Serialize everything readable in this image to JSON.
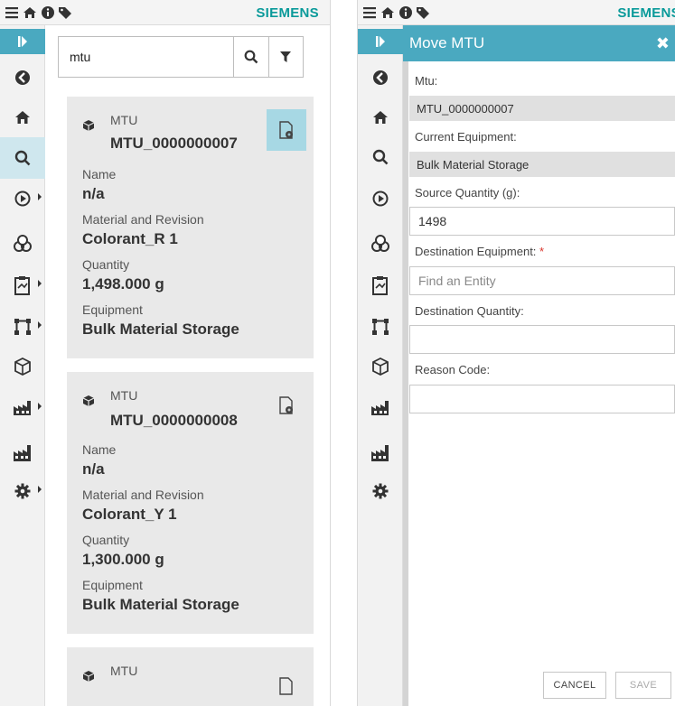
{
  "brand": "SIEMENS",
  "colors": {
    "accent": "#4aa9c0",
    "brand": "#0a9a9a",
    "card_bg": "#e9e9e9",
    "selected": "#a7d8e4"
  },
  "topbar_icons": [
    "menu-icon",
    "home-icon",
    "info-icon",
    "tags-icon"
  ],
  "rail_icons": [
    "expand-icon",
    "back-icon",
    "home-icon",
    "search-icon",
    "play-icon",
    "materials-icon",
    "clipboard-icon",
    "routing-icon",
    "box-icon",
    "factory-icon",
    "plant-icon",
    "gear-icon"
  ],
  "search": {
    "value": "mtu"
  },
  "results": [
    {
      "type_label": "MTU",
      "id": "MTU_0000000007",
      "name_label": "Name",
      "name": "n/a",
      "material_label": "Material and Revision",
      "material": "Colorant_R 1",
      "quantity_label": "Quantity",
      "quantity": "1,498.000 g",
      "equipment_label": "Equipment",
      "equipment": "Bulk Material Storage",
      "selected": true
    },
    {
      "type_label": "MTU",
      "id": "MTU_0000000008",
      "name_label": "Name",
      "name": "n/a",
      "material_label": "Material and Revision",
      "material": "Colorant_Y 1",
      "quantity_label": "Quantity",
      "quantity": "1,300.000 g",
      "equipment_label": "Equipment",
      "equipment": "Bulk Material Storage",
      "selected": false
    },
    {
      "type_label": "MTU"
    }
  ],
  "move_panel": {
    "title": "Move MTU",
    "mtu_label": "Mtu:",
    "mtu_value": "MTU_0000000007",
    "current_equipment_label": "Current Equipment:",
    "current_equipment_value": "Bulk Material Storage",
    "source_qty_label": "Source Quantity (g):",
    "source_qty_value": "1498",
    "dest_equipment_label": "Destination Equipment:",
    "required_mark": "*",
    "dest_equipment_placeholder": "Find an Entity",
    "dest_qty_label": "Destination Quantity:",
    "dest_qty_value": "",
    "reason_label": "Reason Code:",
    "reason_value": "",
    "cancel_label": "CANCEL",
    "save_label": "SAVE"
  }
}
